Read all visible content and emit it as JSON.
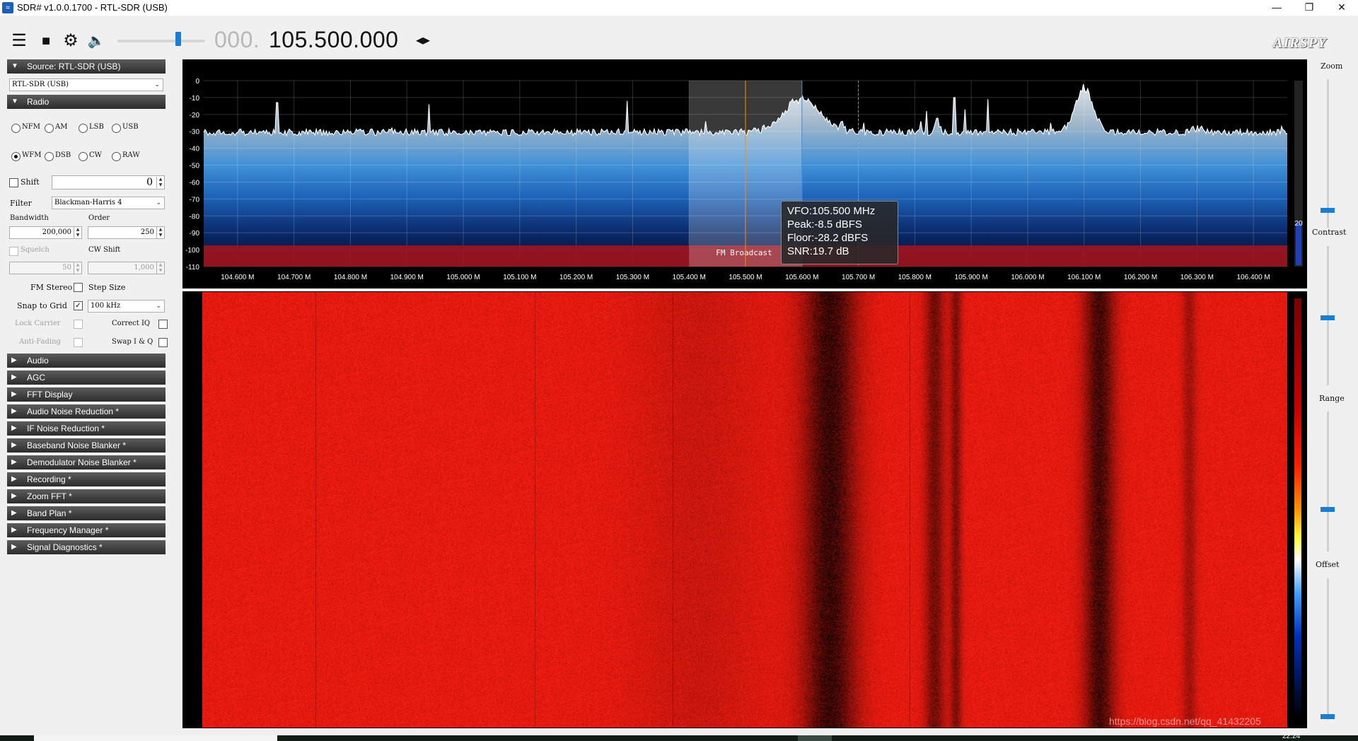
{
  "window": {
    "title": "SDR# v1.0.0.1700 - RTL-SDR (USB)",
    "app_icon": "sdr-icon",
    "controls": [
      "minimize-icon",
      "restore-icon",
      "close-icon"
    ],
    "minimize_glyph": "—",
    "restore_glyph": "❐",
    "close_glyph": "✕"
  },
  "toolbar": {
    "menu_icon": "☰",
    "stop_icon": "■",
    "settings_icon": "⚙",
    "volume_icon": "🔈",
    "volume_level": 0.62,
    "frequency_prefix": "000.",
    "frequency_main": "105.500.000",
    "tune_arrows": "◂▸",
    "logo": "AIRSPY"
  },
  "source_panel": {
    "header": "Source: RTL-SDR (USB)",
    "device": "RTL-SDR (USB)"
  },
  "radio_panel": {
    "header": "Radio",
    "modes_row1": [
      "NFM",
      "AM",
      "LSB",
      "USB"
    ],
    "modes_row2": [
      "WFM",
      "DSB",
      "CW",
      "RAW"
    ],
    "selected_mode": "WFM",
    "shift_label": "Shift",
    "shift_value": "0",
    "filter_label": "Filter",
    "filter_value": "Blackman-Harris 4",
    "bandwidth_label": "Bandwidth",
    "bandwidth_value": "200,000",
    "order_label": "Order",
    "order_value": "250",
    "squelch_label": "Squelch",
    "squelch_value": "50",
    "cw_shift_label": "CW Shift",
    "cw_shift_value": "1,000",
    "fm_stereo_label": "FM Stereo",
    "step_size_label": "Step Size",
    "snap_to_grid_label": "Snap to Grid",
    "step_value": "100 kHz",
    "lock_carrier_label": "Lock Carrier",
    "correct_iq_label": "Correct IQ",
    "anti_fading_label": "Anti-Fading",
    "swap_iq_label": "Swap I & Q"
  },
  "collapsed_sections": [
    "Audio",
    "AGC",
    "FFT Display",
    "Audio Noise Reduction *",
    "IF Noise Reduction *",
    "Baseband Noise Blanker *",
    "Demodulator Noise Blanker *",
    "Recording *",
    "Zoom FFT *",
    "Band Plan *",
    "Frequency Manager *",
    "Signal Diagnostics *"
  ],
  "spectrum": {
    "y_ticks": [
      "0",
      "-10",
      "-20",
      "-30",
      "-40",
      "-50",
      "-60",
      "-70",
      "-80",
      "-90",
      "-100",
      "-110"
    ],
    "x_ticks": [
      "104.600 M",
      "104.700 M",
      "104.800 M",
      "104.900 M",
      "105.000 M",
      "105.100 M",
      "105.200 M",
      "105.300 M",
      "105.400 M",
      "105.500 M",
      "105.600 M",
      "105.700 M",
      "105.800 M",
      "105.900 M",
      "106.000 M",
      "106.100 M",
      "106.200 M",
      "106.300 M",
      "106.400 M"
    ],
    "band_label": "FM Broadcast",
    "level_readout": "20",
    "tooltip": {
      "vfo": "VFO:105.500 MHz",
      "peak": "Peak:-8.5 dBFS",
      "floor": "Floor:-28.2 dBFS",
      "snr": "SNR:19.7 dB"
    },
    "colors": {
      "band_red": "#a0141e",
      "trace": "#ffffff",
      "vfo_line": "#ff8c00",
      "cursor_line": "#2a8cff",
      "marker_green": "#2ecc71"
    }
  },
  "waterfall": {
    "base_color": "#e01b12",
    "watermark": "https://blog.csdn.net/qq_41432205"
  },
  "right_panel": {
    "zoom_label": "Zoom",
    "contrast_label": "Contrast",
    "range_label": "Range",
    "offset_label": "Offset",
    "zoom_level": 0.0,
    "contrast_level": 0.5,
    "range_level": 0.3,
    "offset_level": 0.0
  },
  "taskbar": {
    "clock": "22:24"
  }
}
